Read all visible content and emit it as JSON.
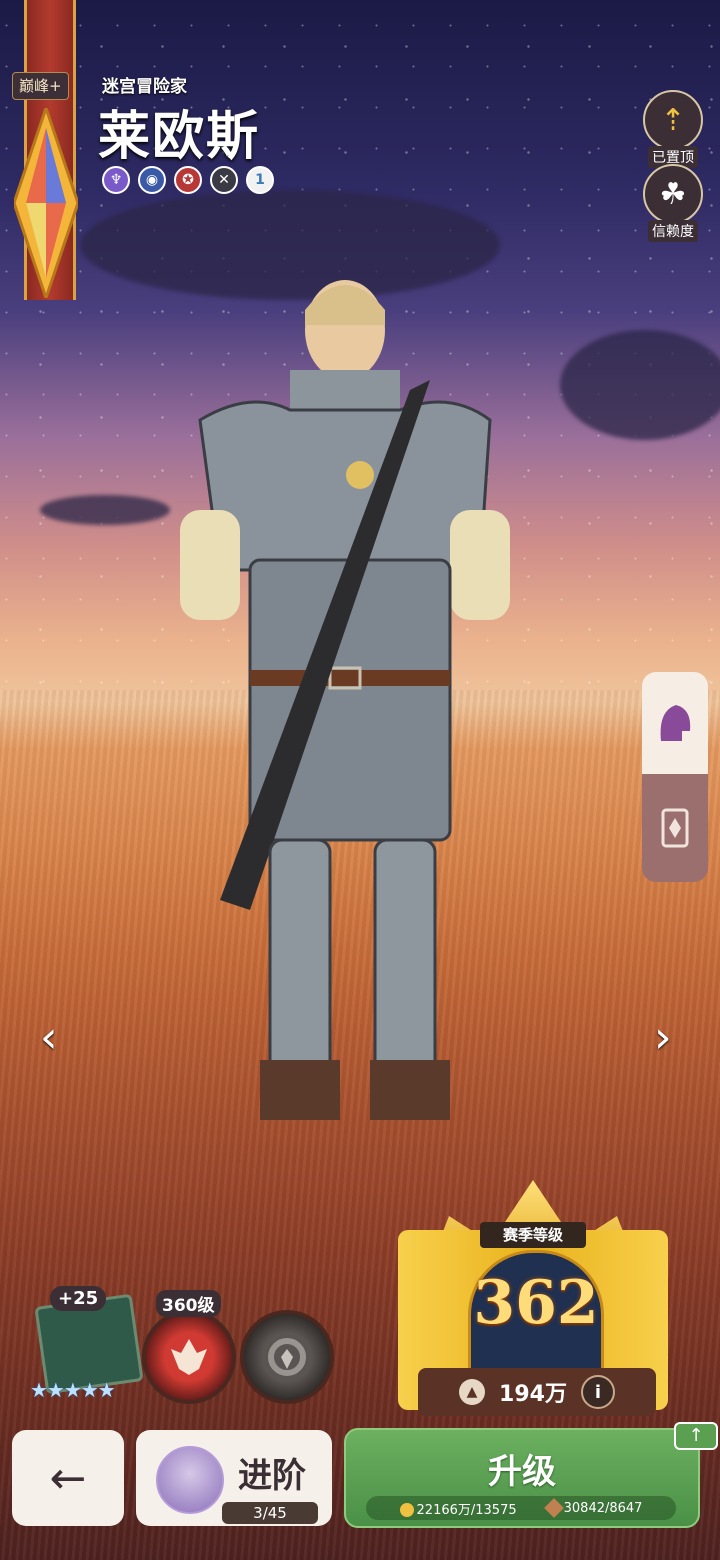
{
  "character": {
    "title": "迷宫冒险家",
    "name": "莱欧斯",
    "rank_tag": "巅峰+",
    "skill_badge_number": "1"
  },
  "top_buttons": {
    "pinned_label": "已置顶",
    "trust_label": "信赖度"
  },
  "season": {
    "title": "赛季等级",
    "level": "362",
    "currency": "194万",
    "info_icon": "i"
  },
  "book": {
    "bonus": "+25",
    "stars": "★★★★★"
  },
  "orb": {
    "level": "360级"
  },
  "bottom": {
    "back_icon": "←",
    "advance_label": "进阶",
    "advance_progress": "3/45",
    "upgrade_label": "升级",
    "gold_cost": "22166万/13575",
    "material_cost": "30842/8647",
    "upgrade_badge": "↑"
  },
  "nav": {
    "left_arrow": "‹",
    "right_arrow": "›"
  }
}
